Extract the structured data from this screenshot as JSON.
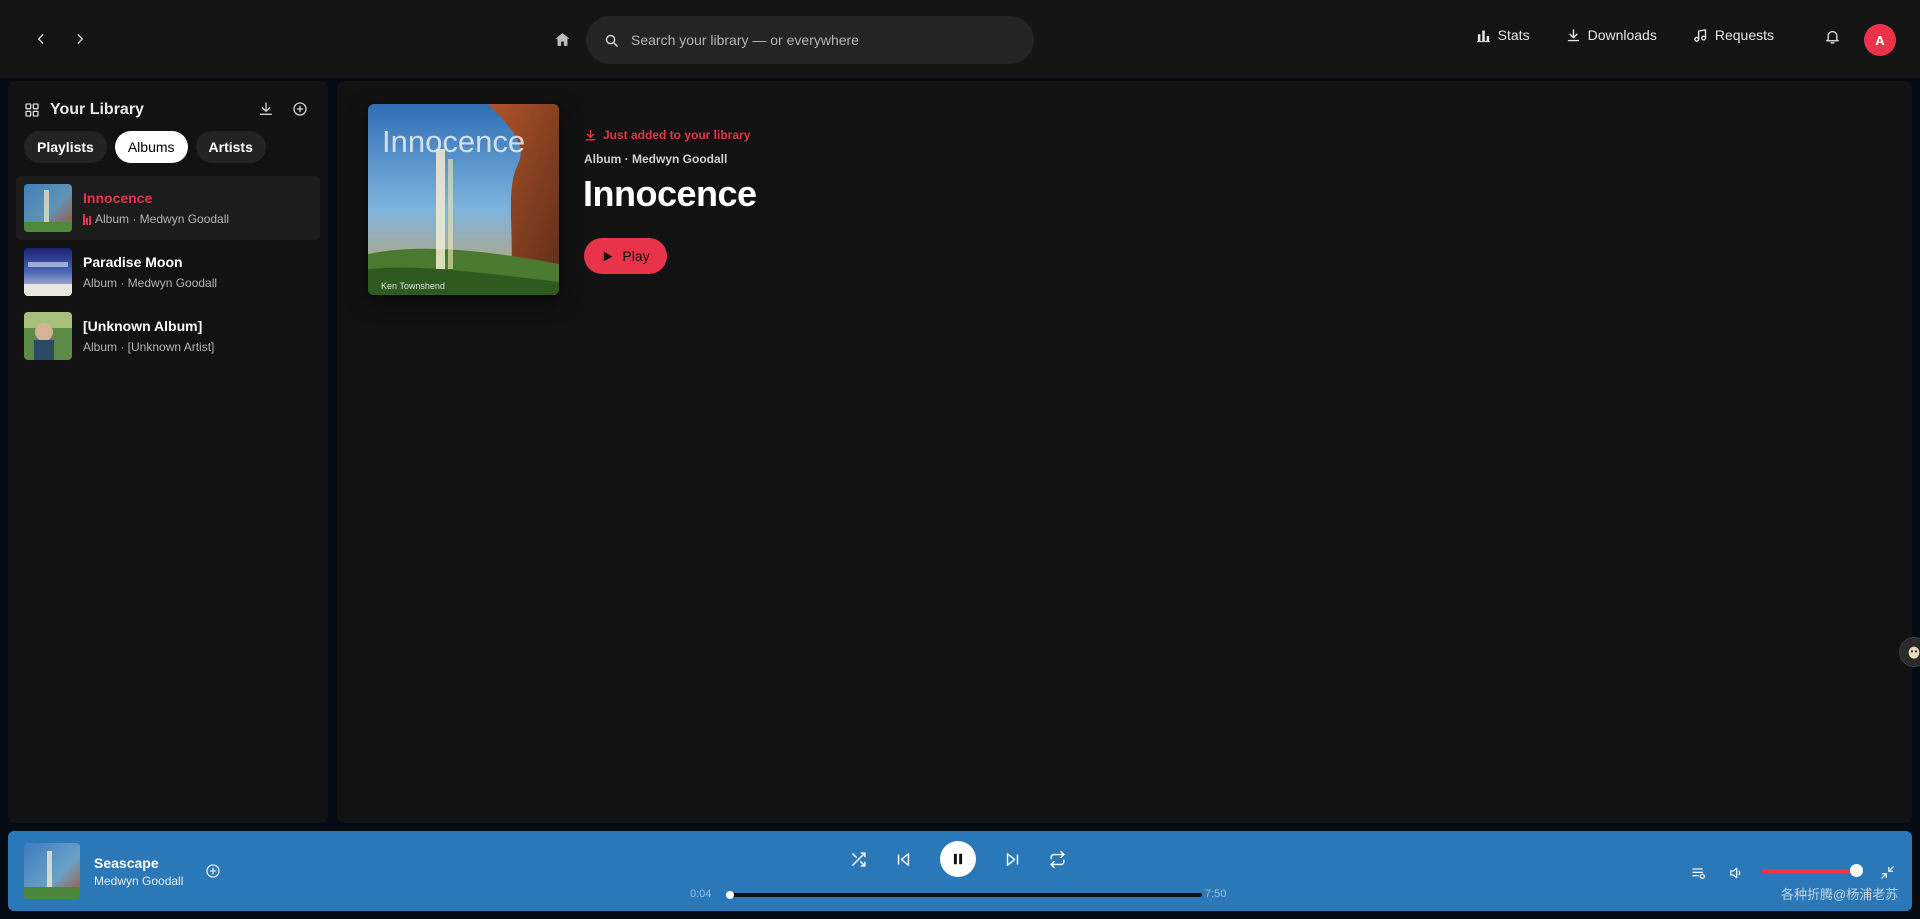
{
  "topbar": {
    "search_placeholder": "Search your library — or everywhere",
    "links": [
      {
        "label": "Stats",
        "icon": "bar-chart-icon"
      },
      {
        "label": "Downloads",
        "icon": "download-icon"
      },
      {
        "label": "Requests",
        "icon": "music-note-icon"
      }
    ],
    "avatar_initial": "A"
  },
  "sidebar": {
    "title": "Your Library",
    "tabs": [
      {
        "label": "Playlists",
        "active": false
      },
      {
        "label": "Albums",
        "active": true
      },
      {
        "label": "Artists",
        "active": false
      }
    ],
    "items": [
      {
        "name": "Innocence",
        "subtitle": "Album · Medwyn Goodall",
        "playing": true
      },
      {
        "name": "Paradise Moon",
        "subtitle": "Album · Medwyn Goodall",
        "playing": false
      },
      {
        "name": "[Unknown Album]",
        "subtitle": "Album · [Unknown Artist]",
        "playing": false
      }
    ]
  },
  "album": {
    "cover_text": "Innocence",
    "cover_credit": "Ken Townshend",
    "added_notice": "Just added to your library",
    "meta": "Album · Medwyn Goodall",
    "title": "Innocence",
    "play_label": "Play"
  },
  "player": {
    "track_title": "Seascape",
    "track_artist": "Medwyn Goodall",
    "elapsed": "0:04",
    "duration": "7:50",
    "progress_fraction": 0.009,
    "volume_fraction": 1.0
  },
  "watermark": "各种折腾@杨浦老苏",
  "colors": {
    "accent": "#e8334a",
    "player_bg": "#2a78b8",
    "panel_bg": "#121212"
  }
}
